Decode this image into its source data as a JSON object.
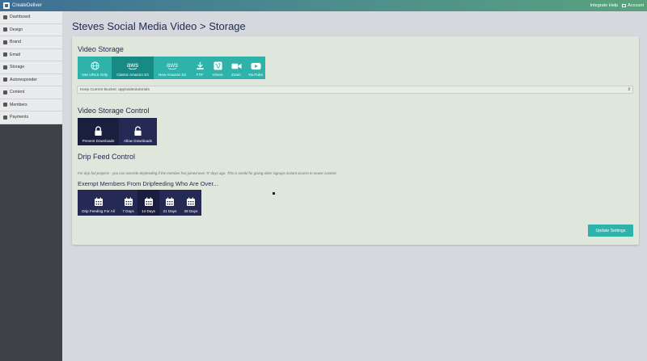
{
  "topbar": {
    "brand": "CreateDeliver",
    "links": [
      "Integrate Help",
      "Account"
    ]
  },
  "sidebar": {
    "items": [
      {
        "label": "Dashboard",
        "icon": "home-icon"
      },
      {
        "label": "Design",
        "icon": "pencil-icon"
      },
      {
        "label": "Brand",
        "icon": "edit-icon"
      },
      {
        "label": "Email",
        "icon": "envelope-icon"
      },
      {
        "label": "Storage",
        "icon": "cloud-icon"
      },
      {
        "label": "Autoresponder",
        "icon": "reply-icon"
      },
      {
        "label": "Content",
        "icon": "file-icon"
      },
      {
        "label": "Members",
        "icon": "users-icon"
      },
      {
        "label": "Payments",
        "icon": "cart-icon"
      }
    ]
  },
  "page": {
    "title": "Steves Social Media Video > Storage"
  },
  "video_storage": {
    "heading": "Video Storage",
    "options": [
      {
        "label": "Use URLS Only",
        "icon": "globe-icon"
      },
      {
        "label": "Classic Amazon S3",
        "icon": "aws-icon",
        "active": true
      },
      {
        "label": "New Amazon S3",
        "icon": "aws-icon"
      },
      {
        "label": "FTP",
        "icon": "download-icon"
      },
      {
        "label": "Vimeo",
        "icon": "vimeo-icon"
      },
      {
        "label": "Zoom",
        "icon": "video-camera-icon"
      },
      {
        "label": "YouTube",
        "icon": "youtube-icon"
      }
    ],
    "aws_word": "aws",
    "bucket_select": "Keep Current Bucket: appsvideotutorials"
  },
  "video_storage_control": {
    "heading": "Video Storage Control",
    "options": [
      {
        "label": "Prevent Downloads",
        "icon": "lock-icon",
        "active": true
      },
      {
        "label": "Allow Downloads",
        "icon": "unlock-icon"
      }
    ]
  },
  "drip_feed": {
    "heading": "Drip Feed Control",
    "note": "For drip fed projects - you can override dripfeeding if the member has joined over 'X' days ago. This is useful for giving older signups instant access to newer content.",
    "exempt_heading": "Exempt Members From Dripfeeding Who Are Over...",
    "options": [
      {
        "label": "Drip Feeding For All",
        "icon": "calendar-icon"
      },
      {
        "label": "7 Days",
        "icon": "calendar-icon"
      },
      {
        "label": "14 Days",
        "icon": "calendar-icon",
        "active": true
      },
      {
        "label": "21 Days",
        "icon": "calendar-icon"
      },
      {
        "label": "28 Days",
        "icon": "calendar-icon"
      }
    ]
  },
  "actions": {
    "update_label": "Update Settings"
  },
  "colors": {
    "teal": "#2fb2aa",
    "teal_active": "#178a84",
    "navy": "#252a55",
    "navy_active": "#1b1f3f"
  }
}
